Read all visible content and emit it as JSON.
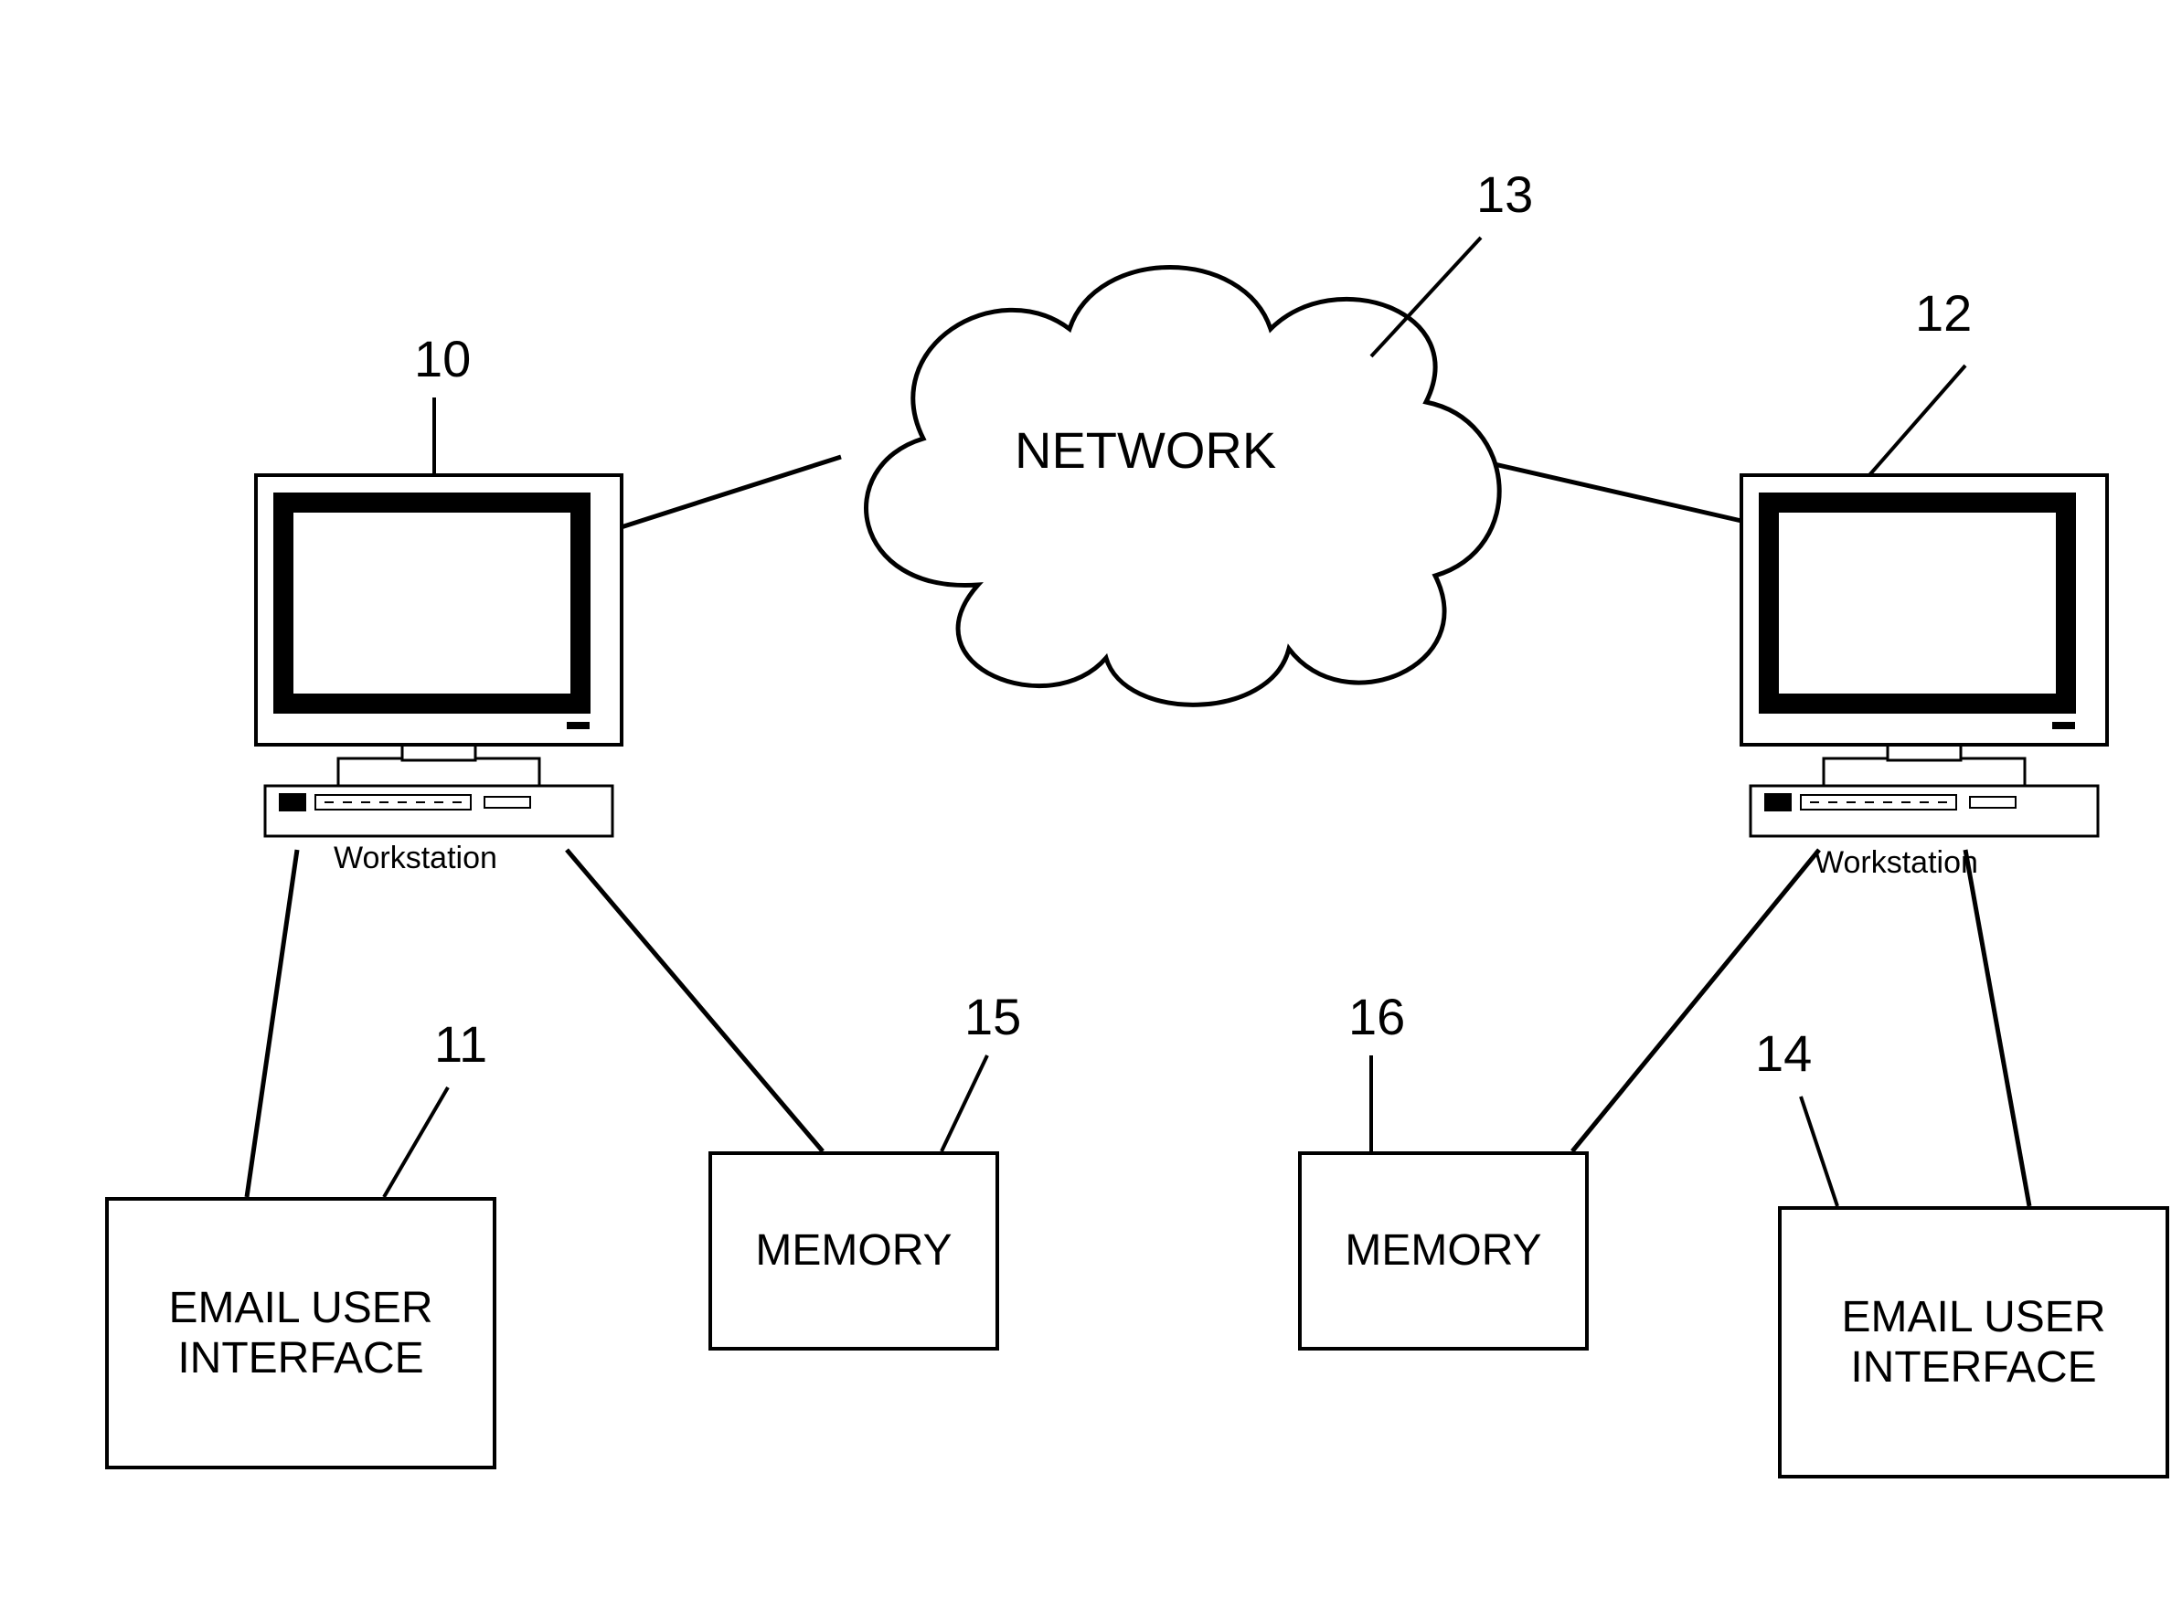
{
  "refs": {
    "workstation_left": "10",
    "email_left": "11",
    "workstation_right": "12",
    "network": "13",
    "email_right": "14",
    "memory_left": "15",
    "memory_right": "16"
  },
  "labels": {
    "network": "NETWORK",
    "workstation": "Workstation",
    "memory": "MEMORY",
    "email_ui_line1": "EMAIL USER",
    "email_ui_line2": "INTERFACE"
  }
}
